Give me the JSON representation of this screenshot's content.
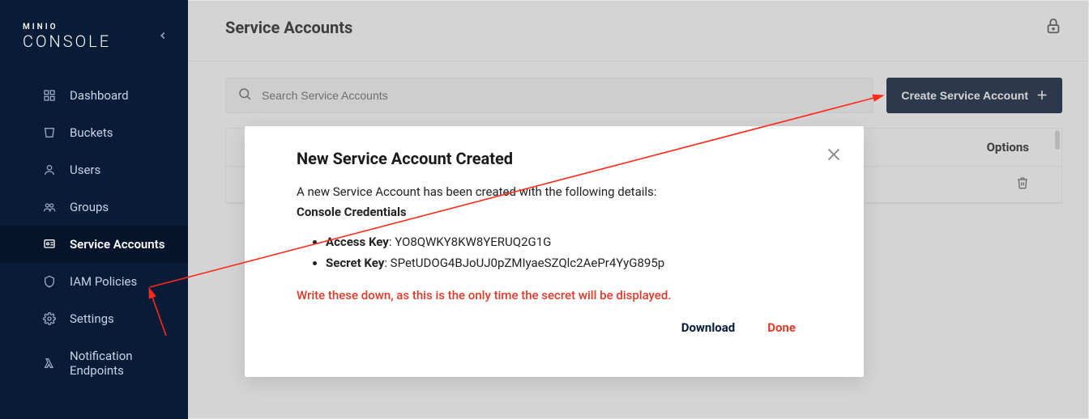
{
  "brand": {
    "small": "MINIO",
    "big": "CONSOLE"
  },
  "sidebar": {
    "items": [
      {
        "label": "Dashboard"
      },
      {
        "label": "Buckets"
      },
      {
        "label": "Users"
      },
      {
        "label": "Groups"
      },
      {
        "label": "Service Accounts"
      },
      {
        "label": "IAM Policies"
      },
      {
        "label": "Settings"
      },
      {
        "label": "Notification Endpoints"
      }
    ],
    "active_index": 4
  },
  "page": {
    "title": "Service Accounts",
    "search_placeholder": "Search Service Accounts",
    "create_button": "Create Service Account",
    "options_header": "Options"
  },
  "modal": {
    "title": "New Service Account Created",
    "intro": "A new Service Account has been created with the following details:",
    "subtitle": "Console Credentials",
    "access_key_label": "Access Key",
    "access_key_value": "YO8QWKY8KW8YERUQ2G1G",
    "secret_key_label": "Secret Key",
    "secret_key_value": "SPetUDOG4BJoUJ0pZMIyaeSZQlc2AePr4YyG895p",
    "warning": "Write these down, as this is the only time the secret will be displayed.",
    "download": "Download",
    "done": "Done"
  },
  "colors": {
    "accent": "#081b37",
    "danger": "#e03b2a"
  }
}
